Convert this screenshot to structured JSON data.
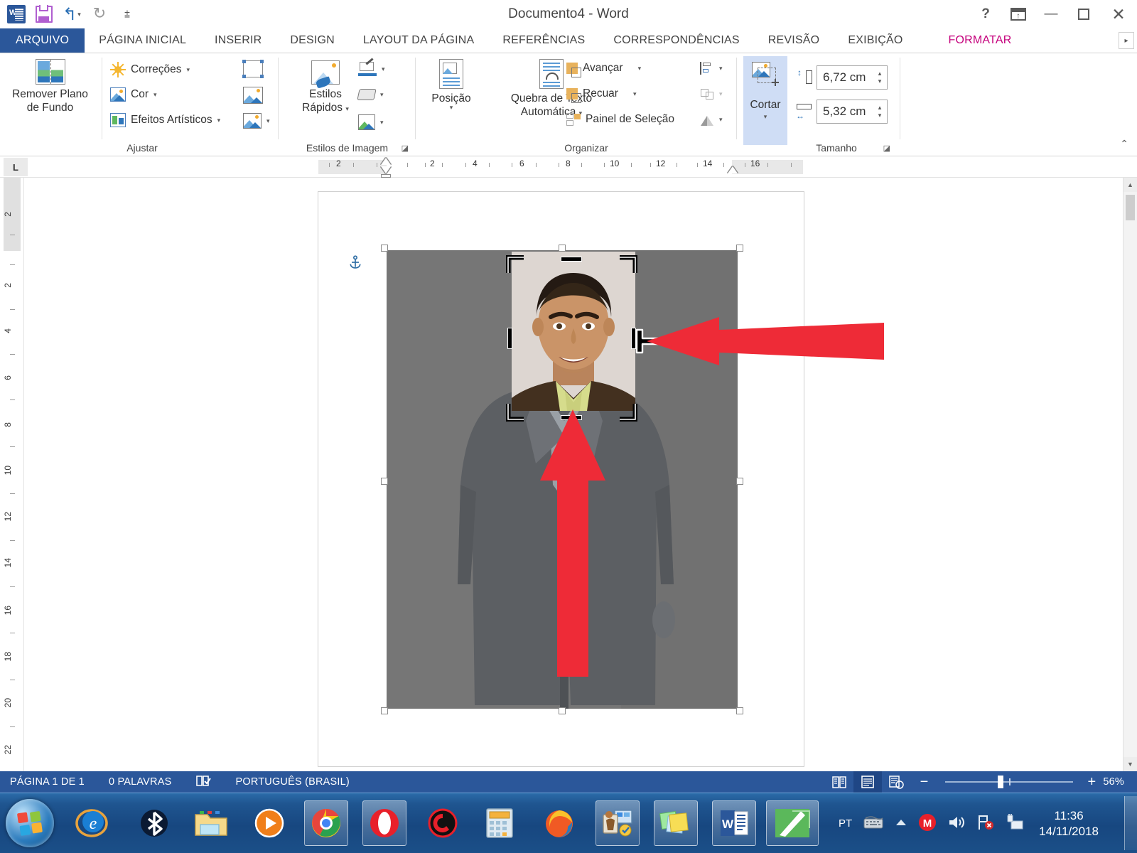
{
  "titlebar": {
    "document_title": "Documento4 - Word",
    "quick_access": [
      {
        "name": "word-logo-icon",
        "label": ""
      },
      {
        "name": "save-icon",
        "label": ""
      },
      {
        "name": "undo-icon",
        "label": ""
      },
      {
        "name": "redo-icon",
        "label": ""
      },
      {
        "name": "customize-qat-icon",
        "label": ""
      }
    ],
    "window_buttons": [
      {
        "name": "help-button",
        "glyph": "?"
      },
      {
        "name": "ribbon-display-options-button",
        "glyph": ""
      },
      {
        "name": "minimize-button",
        "glyph": "—"
      },
      {
        "name": "restore-button",
        "glyph": ""
      },
      {
        "name": "close-button",
        "glyph": "✕"
      }
    ]
  },
  "tabs": [
    {
      "label": "ARQUIVO",
      "state": "file"
    },
    {
      "label": "PÁGINA INICIAL",
      "state": "normal"
    },
    {
      "label": "INSERIR",
      "state": "normal"
    },
    {
      "label": "DESIGN",
      "state": "normal"
    },
    {
      "label": "LAYOUT DA PÁGINA",
      "state": "normal"
    },
    {
      "label": "REFERÊNCIAS",
      "state": "normal"
    },
    {
      "label": "CORRESPONDÊNCIAS",
      "state": "normal"
    },
    {
      "label": "REVISÃO",
      "state": "normal"
    },
    {
      "label": "EXIBIÇÃO",
      "state": "normal"
    },
    {
      "label": "FORMATAR",
      "state": "active-contextual"
    }
  ],
  "ribbon": {
    "groups": [
      {
        "name": "ajustar",
        "label": "Ajustar",
        "big_button": {
          "label_line1": "Remover Plano",
          "label_line2": "de Fundo",
          "icon": "remove-background-icon"
        },
        "items": [
          {
            "label": "Correções",
            "icon": "corrections-icon",
            "has_dropdown": true
          },
          {
            "label": "Cor",
            "icon": "color-icon",
            "has_dropdown": true
          },
          {
            "label": "Efeitos Artísticos",
            "icon": "artistic-effects-icon",
            "has_dropdown": true
          }
        ],
        "icon_only_items": [
          {
            "name": "compress-pictures-icon"
          },
          {
            "name": "change-picture-icon"
          },
          {
            "name": "reset-picture-icon",
            "has_dropdown": true
          }
        ]
      },
      {
        "name": "estilos-de-imagem",
        "label": "Estilos de Imagem",
        "big_button": {
          "label_line1": "Estilos",
          "label_line2": "Rápidos",
          "icon": "quick-styles-icon",
          "has_dropdown": true
        },
        "icon_only_items": [
          {
            "name": "picture-border-icon",
            "has_dropdown": true
          },
          {
            "name": "picture-effects-icon",
            "has_dropdown": true
          },
          {
            "name": "picture-layout-icon",
            "has_dropdown": true
          }
        ],
        "dialog_launcher": true
      },
      {
        "name": "organizar",
        "label": "Organizar",
        "big_buttons": [
          {
            "label_line1": "Posição",
            "label_line2": "",
            "icon": "position-icon",
            "has_dropdown": true
          },
          {
            "label_line1": "Quebra de Texto",
            "label_line2": "Automática",
            "icon": "text-wrap-icon",
            "has_dropdown": true
          }
        ],
        "items": [
          {
            "label": "Avançar",
            "icon": "bring-forward-icon",
            "has_dropdown": true
          },
          {
            "label": "Recuar",
            "icon": "send-backward-icon",
            "has_dropdown": true
          },
          {
            "label": "Painel de Seleção",
            "icon": "selection-pane-icon",
            "has_dropdown": false
          }
        ],
        "icon_only_items": [
          {
            "name": "align-icon",
            "has_dropdown": true
          },
          {
            "name": "group-icon",
            "has_dropdown": true
          },
          {
            "name": "rotate-icon",
            "has_dropdown": true
          }
        ]
      },
      {
        "name": "tamanho",
        "label": "Tamanho",
        "big_button": {
          "label_line1": "Cortar",
          "label_line2": "",
          "icon": "crop-icon",
          "has_dropdown": true,
          "selected": true
        },
        "fields": [
          {
            "name": "shape-height-field",
            "icon": "height-icon",
            "value": "6,72 cm"
          },
          {
            "name": "shape-width-field",
            "icon": "width-icon",
            "value": "5,32 cm"
          }
        ],
        "dialog_launcher": true
      }
    ],
    "collapse_label": "⌃"
  },
  "ruler": {
    "tab_selector": "L",
    "horizontal_major_ticks": [
      "2",
      "",
      "2",
      "4",
      "6",
      "8",
      "10",
      "12",
      "14",
      "16"
    ],
    "vertical_major_ticks": [
      "2",
      "",
      "2",
      "4",
      "6",
      "8",
      "10",
      "12",
      "14",
      "16",
      "18",
      "20",
      "22"
    ]
  },
  "document": {
    "picture": {
      "name": "man-in-suit-photo",
      "crop_mode": true,
      "crop_region_label": "face-crop-region"
    },
    "annotations": [
      {
        "name": "red-arrow-pointing-left",
        "direction": "left"
      },
      {
        "name": "red-arrow-pointing-up",
        "direction": "up"
      }
    ],
    "cursor": "crop-handle-cursor"
  },
  "statusbar": {
    "page_info": "PÁGINA 1 DE 1",
    "word_count": "0 PALAVRAS",
    "proofing_icon": "proofing-errors-icon",
    "language": "PORTUGUÊS (BRASIL)",
    "views": [
      {
        "name": "read-mode-button",
        "selected": false
      },
      {
        "name": "print-layout-button",
        "selected": true
      },
      {
        "name": "web-layout-button",
        "selected": false
      }
    ],
    "zoom_out": "−",
    "zoom_in": "+",
    "zoom_level": "56%"
  },
  "taskbar": {
    "start_button": "windows-start-orb",
    "pinned": [
      {
        "name": "internet-explorer-icon",
        "open": false
      },
      {
        "name": "bluetooth-icon",
        "open": false
      },
      {
        "name": "file-explorer-icon",
        "open": false
      },
      {
        "name": "media-player-icon",
        "open": false
      },
      {
        "name": "google-chrome-icon",
        "open": true
      },
      {
        "name": "opera-icon",
        "open": true
      },
      {
        "name": "ccleaner-icon",
        "open": false
      },
      {
        "name": "calculator-icon",
        "open": false
      },
      {
        "name": "mozilla-firefox-icon",
        "open": false
      },
      {
        "name": "remote-desktop-icon",
        "open": true
      },
      {
        "name": "sticky-notes-icon",
        "open": true
      },
      {
        "name": "microsoft-word-icon",
        "open": true
      },
      {
        "name": "wps-writer-icon",
        "open": true
      }
    ],
    "tray": {
      "language": "PT",
      "icons": [
        {
          "name": "keyboard-layout-icon"
        },
        {
          "name": "show-hidden-icons-icon"
        },
        {
          "name": "mega-icon"
        },
        {
          "name": "volume-icon"
        },
        {
          "name": "network-error-icon"
        },
        {
          "name": "safely-remove-hardware-icon"
        }
      ],
      "time": "11:36",
      "date": "14/11/2018"
    },
    "show_desktop": "show-desktop-button"
  },
  "colors": {
    "word_blue": "#2b579a",
    "contextual_tab": "#c5007c",
    "annotation_red": "#ee2b37",
    "crop_selected_bg": "#cfddf5"
  }
}
